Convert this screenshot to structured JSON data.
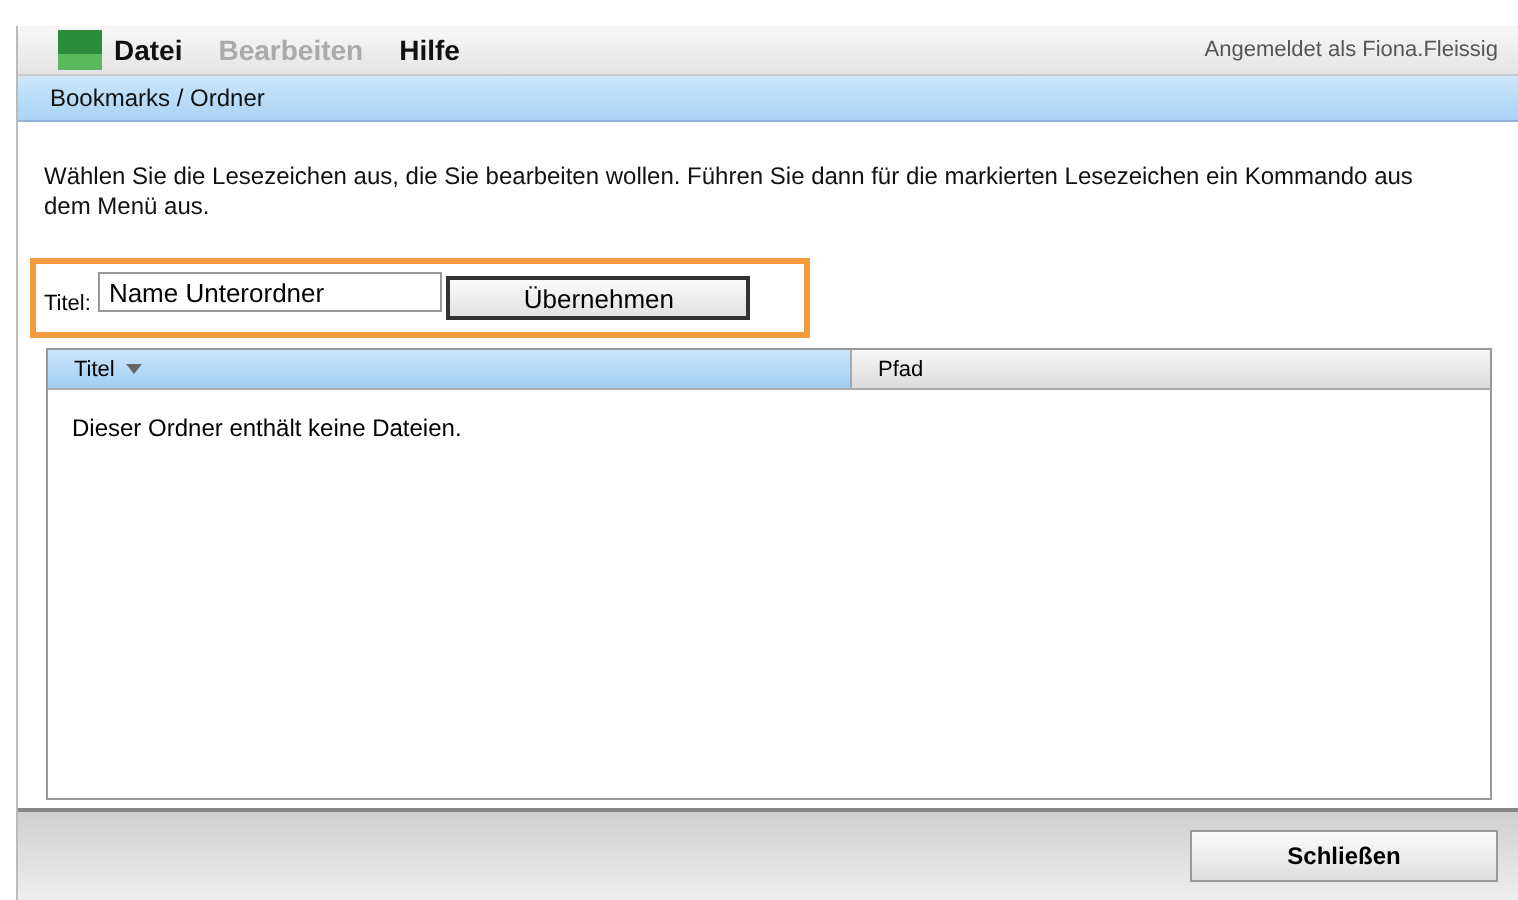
{
  "menu": {
    "items": [
      {
        "label": "Datei",
        "disabled": false
      },
      {
        "label": "Bearbeiten",
        "disabled": true
      },
      {
        "label": "Hilfe",
        "disabled": false
      }
    ],
    "user": "Angemeldet als Fiona.Fleissig"
  },
  "breadcrumb": "Bookmarks / Ordner",
  "instructions": "Wählen Sie die Lesezeichen aus, die Sie bearbeiten wollen. Führen Sie dann für die markierten Lesezeichen ein Kommando aus dem Menü aus.",
  "title_form": {
    "label": "Titel:",
    "value": "Name Unterordner",
    "button": "Übernehmen"
  },
  "table": {
    "columns": [
      {
        "label": "Titel",
        "sorted": true
      },
      {
        "label": "Pfad",
        "sorted": false
      }
    ],
    "empty_message": "Dieser Ordner enthält keine Dateien."
  },
  "footer": {
    "button": "Schließen"
  }
}
